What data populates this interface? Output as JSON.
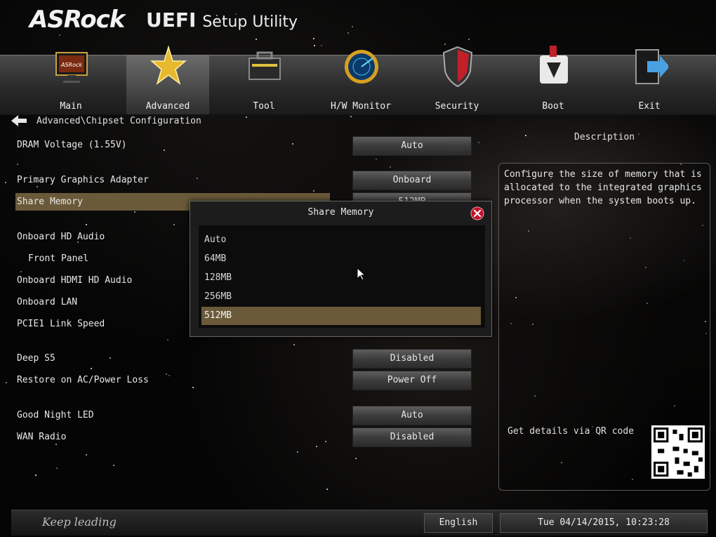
{
  "header": {
    "brand": "ASRock",
    "title_bold": "UEFI",
    "title_rest": "Setup Utility"
  },
  "nav": {
    "tabs": [
      {
        "label": "Main",
        "icon": "monitor-icon"
      },
      {
        "label": "Advanced",
        "icon": "star-icon",
        "active": true
      },
      {
        "label": "Tool",
        "icon": "toolbox-icon"
      },
      {
        "label": "H/W Monitor",
        "icon": "radar-icon"
      },
      {
        "label": "Security",
        "icon": "shield-icon"
      },
      {
        "label": "Boot",
        "icon": "boot-arrow-icon"
      },
      {
        "label": "Exit",
        "icon": "exit-door-icon"
      }
    ]
  },
  "breadcrumb": "Advanced\\Chipset Configuration",
  "settings": [
    {
      "label": "DRAM Voltage (1.55V)",
      "value": "Auto"
    },
    {
      "label": "Primary Graphics Adapter",
      "value": "Onboard"
    },
    {
      "label": "Share Memory",
      "value": "512MB"
    },
    {
      "label": "Onboard HD Audio"
    },
    {
      "label": "Front Panel"
    },
    {
      "label": "Onboard HDMI HD Audio"
    },
    {
      "label": "Onboard LAN"
    },
    {
      "label": "PCIE1 Link Speed"
    },
    {
      "label": "Deep S5",
      "value": "Disabled"
    },
    {
      "label": "Restore on AC/Power Loss",
      "value": "Power Off"
    },
    {
      "label": "Good Night LED",
      "value": "Auto"
    },
    {
      "label": "WAN Radio",
      "value": "Disabled"
    }
  ],
  "description": {
    "title": "Description",
    "text": "Configure the size of memory that is allocated to the integrated graphics processor when the system boots up.",
    "qr_label": "Get details via QR code"
  },
  "popup": {
    "title": "Share Memory",
    "options": [
      "Auto",
      "64MB",
      "128MB",
      "256MB",
      "512MB"
    ],
    "selected": "512MB"
  },
  "footer": {
    "slogan": "Keep leading",
    "language": "English",
    "datetime": "Tue 04/14/2015, 10:23:28"
  },
  "colors": {
    "highlight": "#6a5a3a",
    "background": "#050505",
    "close_button": "#c8102e"
  }
}
